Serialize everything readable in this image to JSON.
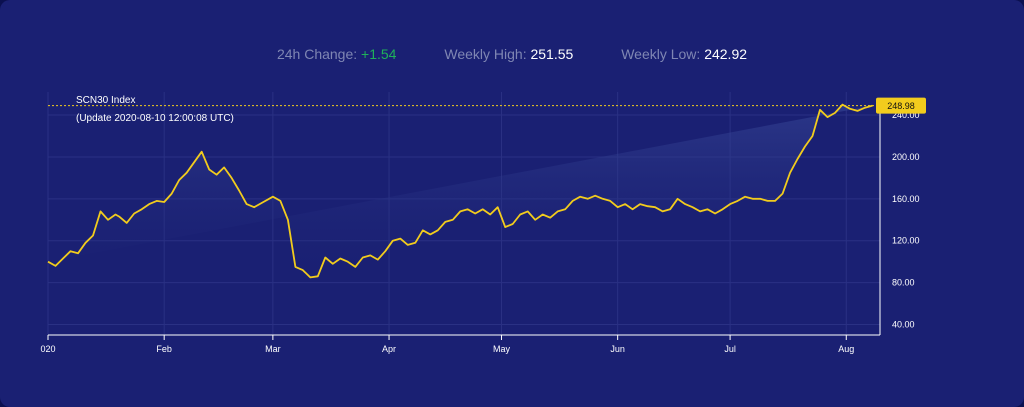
{
  "stats": {
    "change_label": "24h Change:",
    "change_value": "+1.54",
    "high_label": "Weekly High:",
    "high_value": "251.55",
    "low_label": "Weekly Low:",
    "low_value": "242.92"
  },
  "colors": {
    "background": "#1a2073",
    "line": "#f2cc1d",
    "up": "#1fb15a",
    "grid": "#2a3184",
    "label_box": "#f2cc1d"
  },
  "chart_data": {
    "type": "area",
    "title": "SCN30 Index",
    "subtitle": "(Update 2020-08-10 12:00:08 UTC)",
    "ylim": [
      30,
      262
    ],
    "yticks": [
      40,
      80,
      120,
      160,
      200,
      240
    ],
    "ytick_labels": [
      "40.00",
      "80.00",
      "120.00",
      "160.00",
      "200.00",
      "240.00"
    ],
    "xticks": [
      {
        "label": "020",
        "date": "2020-01-01"
      },
      {
        "label": "Feb",
        "date": "2020-02-01"
      },
      {
        "label": "Mar",
        "date": "2020-03-01"
      },
      {
        "label": "Apr",
        "date": "2020-04-01"
      },
      {
        "label": "May",
        "date": "2020-05-01"
      },
      {
        "label": "Jun",
        "date": "2020-06-01"
      },
      {
        "label": "Jul",
        "date": "2020-07-01"
      },
      {
        "label": "Aug",
        "date": "2020-08-01"
      }
    ],
    "last_value_label": "248.98",
    "last_value": 248.98,
    "x": [
      "2020-01-01",
      "2020-01-03",
      "2020-01-05",
      "2020-01-07",
      "2020-01-09",
      "2020-01-11",
      "2020-01-13",
      "2020-01-15",
      "2020-01-17",
      "2020-01-19",
      "2020-01-20",
      "2020-01-22",
      "2020-01-24",
      "2020-01-26",
      "2020-01-28",
      "2020-01-30",
      "2020-02-01",
      "2020-02-03",
      "2020-02-05",
      "2020-02-07",
      "2020-02-09",
      "2020-02-11",
      "2020-02-13",
      "2020-02-15",
      "2020-02-17",
      "2020-02-19",
      "2020-02-21",
      "2020-02-23",
      "2020-02-25",
      "2020-02-27",
      "2020-03-01",
      "2020-03-03",
      "2020-03-05",
      "2020-03-07",
      "2020-03-09",
      "2020-03-11",
      "2020-03-13",
      "2020-03-15",
      "2020-03-17",
      "2020-03-19",
      "2020-03-21",
      "2020-03-23",
      "2020-03-25",
      "2020-03-27",
      "2020-03-29",
      "2020-03-31",
      "2020-04-02",
      "2020-04-04",
      "2020-04-06",
      "2020-04-08",
      "2020-04-10",
      "2020-04-12",
      "2020-04-14",
      "2020-04-16",
      "2020-04-18",
      "2020-04-20",
      "2020-04-22",
      "2020-04-24",
      "2020-04-26",
      "2020-04-28",
      "2020-04-30",
      "2020-05-02",
      "2020-05-04",
      "2020-05-06",
      "2020-05-08",
      "2020-05-10",
      "2020-05-12",
      "2020-05-14",
      "2020-05-16",
      "2020-05-18",
      "2020-05-20",
      "2020-05-22",
      "2020-05-24",
      "2020-05-26",
      "2020-05-28",
      "2020-05-30",
      "2020-06-01",
      "2020-06-03",
      "2020-06-05",
      "2020-06-07",
      "2020-06-09",
      "2020-06-11",
      "2020-06-13",
      "2020-06-15",
      "2020-06-17",
      "2020-06-19",
      "2020-06-21",
      "2020-06-23",
      "2020-06-25",
      "2020-06-27",
      "2020-06-29",
      "2020-07-01",
      "2020-07-03",
      "2020-07-05",
      "2020-07-07",
      "2020-07-09",
      "2020-07-11",
      "2020-07-13",
      "2020-07-15",
      "2020-07-17",
      "2020-07-19",
      "2020-07-21",
      "2020-07-23",
      "2020-07-25",
      "2020-07-27",
      "2020-07-29",
      "2020-07-31",
      "2020-08-02",
      "2020-08-04",
      "2020-08-06",
      "2020-08-08",
      "2020-08-10"
    ],
    "values": [
      100,
      96,
      103,
      110,
      108,
      118,
      125,
      148,
      140,
      145,
      143,
      137,
      146,
      150,
      155,
      158,
      157,
      165,
      178,
      185,
      195,
      205,
      188,
      183,
      190,
      180,
      168,
      155,
      152,
      156,
      162,
      158,
      140,
      95,
      92,
      85,
      86,
      104,
      98,
      103,
      100,
      95,
      104,
      106,
      102,
      110,
      120,
      122,
      116,
      118,
      130,
      126,
      130,
      138,
      140,
      148,
      150,
      146,
      150,
      145,
      152,
      133,
      136,
      145,
      148,
      140,
      145,
      142,
      148,
      150,
      158,
      162,
      160,
      163,
      160,
      158,
      152,
      155,
      150,
      155,
      153,
      152,
      148,
      150,
      160,
      155,
      152,
      148,
      150,
      146,
      150,
      155,
      158,
      162,
      160,
      160,
      158,
      158,
      165,
      185,
      198,
      210,
      220,
      245,
      238,
      242,
      250,
      246,
      244,
      247,
      248.98
    ]
  }
}
